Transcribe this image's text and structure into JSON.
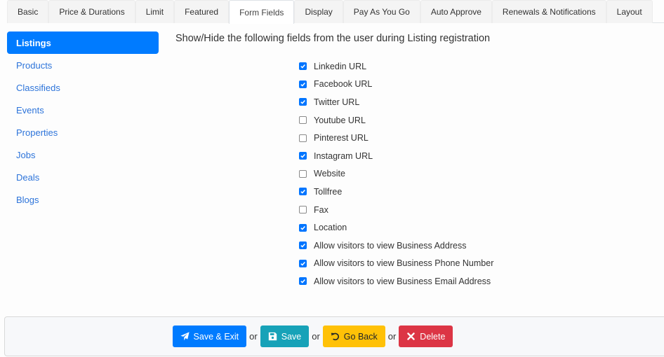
{
  "tabs": [
    {
      "label": "Basic",
      "active": false
    },
    {
      "label": "Price & Durations",
      "active": false
    },
    {
      "label": "Limit",
      "active": false
    },
    {
      "label": "Featured",
      "active": false
    },
    {
      "label": "Form Fields",
      "active": true
    },
    {
      "label": "Display",
      "active": false
    },
    {
      "label": "Pay As You Go",
      "active": false
    },
    {
      "label": "Auto Approve",
      "active": false
    },
    {
      "label": "Renewals & Notifications",
      "active": false
    },
    {
      "label": "Layout",
      "active": false
    }
  ],
  "sidebar": {
    "items": [
      {
        "label": "Listings",
        "active": true
      },
      {
        "label": "Products",
        "active": false
      },
      {
        "label": "Classifieds",
        "active": false
      },
      {
        "label": "Events",
        "active": false
      },
      {
        "label": "Properties",
        "active": false
      },
      {
        "label": "Jobs",
        "active": false
      },
      {
        "label": "Deals",
        "active": false
      },
      {
        "label": "Blogs",
        "active": false
      }
    ]
  },
  "main": {
    "heading": "Show/Hide the following fields from the user during Listing registration",
    "fields": [
      {
        "label": "Linkedin URL",
        "checked": true
      },
      {
        "label": "Facebook URL",
        "checked": true
      },
      {
        "label": "Twitter URL",
        "checked": true
      },
      {
        "label": "Youtube URL",
        "checked": false
      },
      {
        "label": "Pinterest URL",
        "checked": false
      },
      {
        "label": "Instagram URL",
        "checked": true
      },
      {
        "label": "Website",
        "checked": false
      },
      {
        "label": "Tollfree",
        "checked": true
      },
      {
        "label": "Fax",
        "checked": false
      },
      {
        "label": "Location",
        "checked": true
      },
      {
        "label": "Allow visitors to view Business Address",
        "checked": true
      },
      {
        "label": "Allow visitors to view Business Phone Number",
        "checked": true
      },
      {
        "label": "Allow visitors to view Business Email Address",
        "checked": true
      }
    ]
  },
  "footer": {
    "save_exit_label": "Save & Exit",
    "save_label": "Save",
    "go_back_label": "Go Back",
    "delete_label": "Delete",
    "separator": "or",
    "icons": {
      "save_exit": "paper-plane-icon",
      "save": "floppy-disk-icon",
      "go_back": "undo-icon",
      "delete": "times-icon"
    }
  },
  "colors": {
    "primary": "#007bff",
    "info": "#17a2b8",
    "warning": "#ffc107",
    "danger": "#dc3545",
    "link": "#2d74da",
    "checkbox": "#0075ff"
  }
}
